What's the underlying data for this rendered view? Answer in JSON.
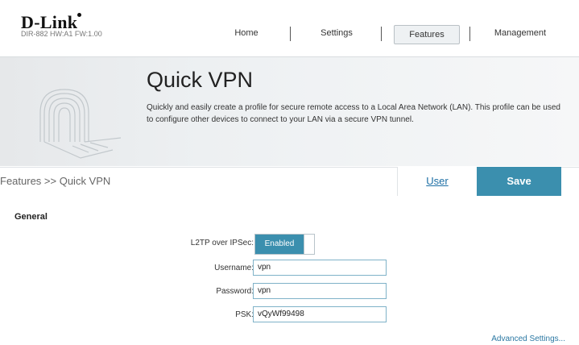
{
  "brand": {
    "logo": "D-Link",
    "model": "DIR-882 HW:A1 FW:1.00"
  },
  "nav": {
    "home": "Home",
    "settings": "Settings",
    "features": "Features",
    "management": "Management"
  },
  "banner": {
    "title": "Quick VPN",
    "description": "Quickly and easily create a profile for secure remote access to a Local Area Network (LAN). This profile can be used to configure other devices to connect to your LAN via a secure VPN tunnel."
  },
  "breadcrumb": "Features >> Quick VPN",
  "actions": {
    "user": "User",
    "save": "Save"
  },
  "general": {
    "title": "General",
    "l2tp_label": "L2TP over IPSec:",
    "l2tp_state": "Enabled",
    "username_label": "Username:",
    "username_value": "vpn",
    "password_label": "Password:",
    "password_value": "vpn",
    "psk_label": "PSK:",
    "psk_value": "vQyWf99498"
  },
  "advanced_link": "Advanced Settings...",
  "colors": {
    "accent": "#3b8fae",
    "link": "#1d6fa5"
  }
}
